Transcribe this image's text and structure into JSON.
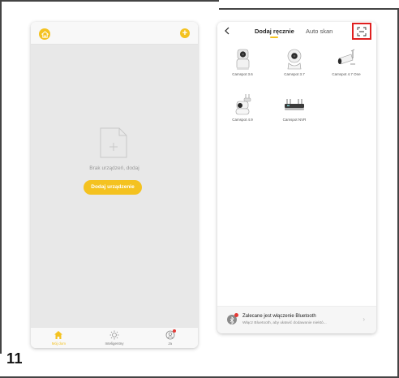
{
  "step_number": "11",
  "home_screen": {
    "add_icon": "plus-icon",
    "empty_state_text": "Brak urządzeń, dodaj",
    "add_device_button": "Dodaj urządzenie",
    "tabs": [
      {
        "label": "Mój dom",
        "icon": "home-icon",
        "active": true
      },
      {
        "label": "Inteligentny",
        "icon": "sun-icon",
        "active": false
      },
      {
        "label": "Ja",
        "icon": "user-icon",
        "active": false
      }
    ]
  },
  "add_screen": {
    "tab_manual": "Dodaj ręcznie",
    "tab_auto": "Auto skan",
    "scan_icon": "scan-icon",
    "devices": [
      {
        "label": "Camspot 3.6",
        "icon": "indoor-camera-icon"
      },
      {
        "label": "Camspot 3.7",
        "icon": "dome-camera-icon"
      },
      {
        "label": "Camspot 4.7 One",
        "icon": "bullet-camera-icon"
      },
      {
        "label": "Camspot 4.9",
        "icon": "outdoor-camera-icon"
      },
      {
        "label": "Camspot NVR",
        "icon": "nvr-icon"
      }
    ],
    "bluetooth_title": "Zalecane jest włączenie Bluetooth",
    "bluetooth_subtitle": "Włącz Bluetooth, aby ułatwić dodawanie niektó..."
  },
  "colors": {
    "accent": "#f4c220",
    "highlight": "#e02020"
  }
}
